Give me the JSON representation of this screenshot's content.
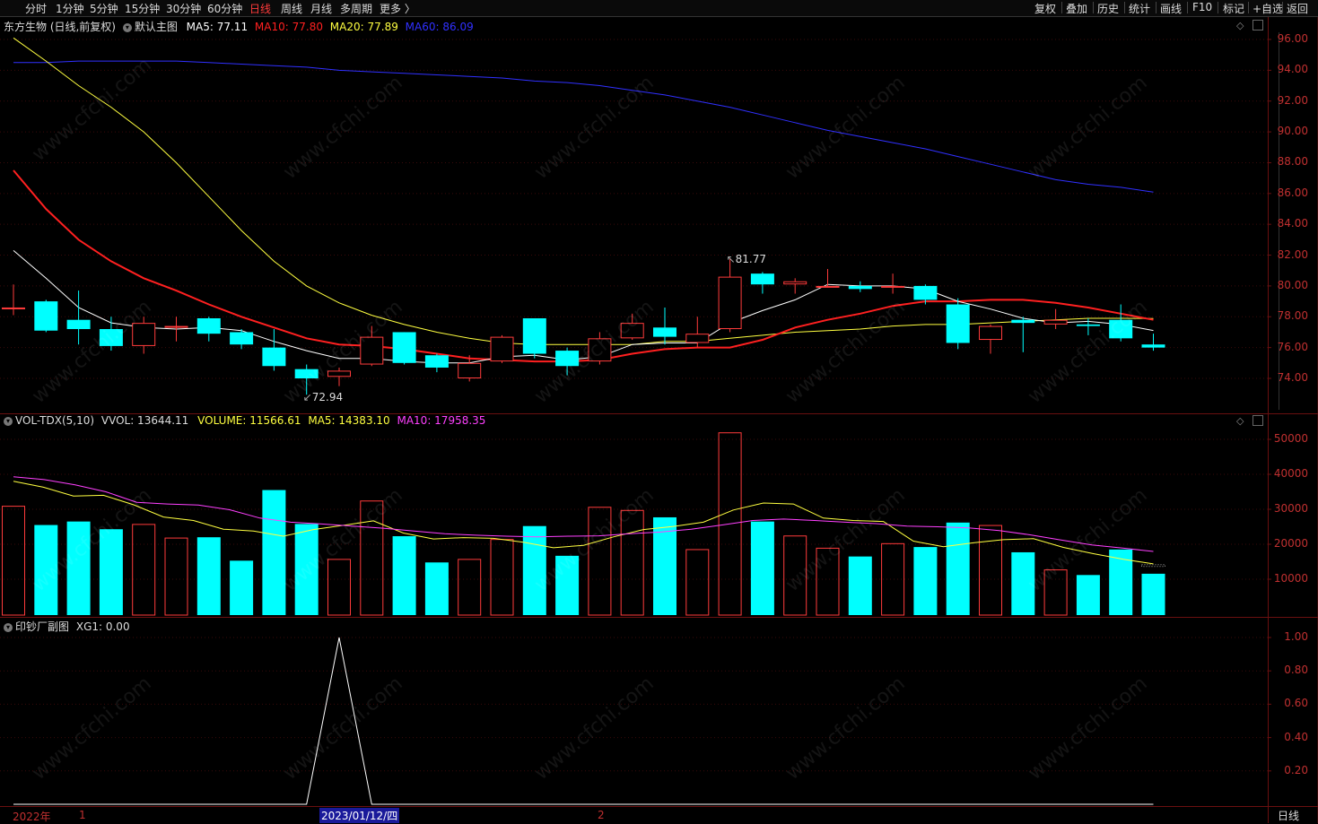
{
  "toolbar": {
    "periods": [
      "分时",
      "1分钟",
      "5分钟",
      "15分钟",
      "30分钟",
      "60分钟",
      "日线",
      "周线",
      "月线",
      "多周期",
      "更多 〉"
    ],
    "active_period": "日线",
    "actions": [
      "复权",
      "叠加",
      "历史",
      "统计",
      "画线",
      "F10",
      "标记",
      "+自选",
      "返回"
    ]
  },
  "main_panel": {
    "title": "东方生物 (日线,前复权)",
    "template": "默认主图",
    "ma5": "MA5: 77.11",
    "ma10": "MA10: 77.80",
    "ma20": "MA20: 77.89",
    "ma60": "MA60: 86.09",
    "high_label": "81.77",
    "low_label": "72.94",
    "yaxis": [
      "96.00",
      "94.00",
      "92.00",
      "90.00",
      "88.00",
      "86.00",
      "84.00",
      "82.00",
      "80.00",
      "78.00",
      "76.00",
      "74.00"
    ]
  },
  "vol_panel": {
    "name": "VOL-TDX(5,10)",
    "vvol": "VVOL: 13644.11",
    "volume": "VOLUME: 11566.61",
    "ma5": "MA5: 14383.10",
    "ma10": "MA10: 17958.35",
    "yaxis": [
      "50000",
      "40000",
      "30000",
      "20000",
      "10000"
    ]
  },
  "sub_panel": {
    "name": "印钞厂副图",
    "xg": "XG1: 0.00",
    "yaxis": [
      "1.00",
      "0.80",
      "0.60",
      "0.40",
      "0.20"
    ]
  },
  "xaxis": {
    "year": "2022年",
    "m1": "1",
    "cursor_date": "2023/01/12/四",
    "m2": "2",
    "period_label": "日线"
  },
  "watermark": "www.cfchi.com",
  "colors": {
    "up": "#ff3b3b",
    "down": "#00ffff",
    "ma5": "#ffffff",
    "ma10": "#ff2020",
    "ma20": "#ffff40",
    "ma60": "#3030ff",
    "vol_ma10": "#ff40ff",
    "grid": "#6a1010"
  },
  "chart_data": {
    "type": "candlestick",
    "candles": [
      {
        "o": 78.6,
        "c": 78.6,
        "h": 80.1,
        "l": 78.1
      },
      {
        "o": 79.0,
        "c": 77.1,
        "h": 79.1,
        "l": 77.0
      },
      {
        "o": 77.8,
        "c": 77.2,
        "h": 79.7,
        "l": 76.2
      },
      {
        "o": 77.2,
        "c": 76.1,
        "h": 78.0,
        "l": 75.8
      },
      {
        "o": 76.1,
        "c": 77.6,
        "h": 78.0,
        "l": 75.6
      },
      {
        "o": 77.4,
        "c": 77.4,
        "h": 78.0,
        "l": 76.4
      },
      {
        "o": 77.9,
        "c": 76.9,
        "h": 78.0,
        "l": 76.4
      },
      {
        "o": 77.0,
        "c": 76.2,
        "h": 77.2,
        "l": 75.9
      },
      {
        "o": 76.0,
        "c": 74.8,
        "h": 77.2,
        "l": 74.5
      },
      {
        "o": 74.6,
        "c": 74.0,
        "h": 74.9,
        "l": 72.94
      },
      {
        "o": 74.1,
        "c": 74.5,
        "h": 74.7,
        "l": 73.5
      },
      {
        "o": 74.9,
        "c": 76.7,
        "h": 77.4,
        "l": 74.8
      },
      {
        "o": 77.0,
        "c": 75.0,
        "h": 77.0,
        "l": 74.9
      },
      {
        "o": 75.5,
        "c": 74.7,
        "h": 75.6,
        "l": 74.4
      },
      {
        "o": 74.0,
        "c": 75.0,
        "h": 75.5,
        "l": 73.8
      },
      {
        "o": 75.1,
        "c": 76.7,
        "h": 76.8,
        "l": 75.0
      },
      {
        "o": 77.9,
        "c": 75.6,
        "h": 77.9,
        "l": 75.3
      },
      {
        "o": 75.8,
        "c": 74.8,
        "h": 76.0,
        "l": 74.2
      },
      {
        "o": 75.1,
        "c": 76.6,
        "h": 77.0,
        "l": 74.9
      },
      {
        "o": 76.6,
        "c": 77.6,
        "h": 78.2,
        "l": 76.5
      },
      {
        "o": 77.3,
        "c": 76.7,
        "h": 78.6,
        "l": 76.2
      },
      {
        "o": 76.3,
        "c": 76.9,
        "h": 78.0,
        "l": 76.0
      },
      {
        "o": 77.2,
        "c": 80.6,
        "h": 81.77,
        "l": 77.0
      },
      {
        "o": 80.8,
        "c": 80.1,
        "h": 80.9,
        "l": 79.5
      },
      {
        "o": 80.1,
        "c": 80.3,
        "h": 80.5,
        "l": 79.5
      },
      {
        "o": 80.0,
        "c": 80.0,
        "h": 81.1,
        "l": 79.9
      },
      {
        "o": 80.0,
        "c": 79.8,
        "h": 80.3,
        "l": 79.6
      },
      {
        "o": 80.0,
        "c": 80.0,
        "h": 80.8,
        "l": 79.5
      },
      {
        "o": 80.0,
        "c": 79.1,
        "h": 80.1,
        "l": 78.8
      },
      {
        "o": 78.8,
        "c": 76.3,
        "h": 79.2,
        "l": 75.9
      },
      {
        "o": 76.5,
        "c": 77.4,
        "h": 77.5,
        "l": 75.6
      },
      {
        "o": 77.8,
        "c": 77.6,
        "h": 78.0,
        "l": 75.7
      },
      {
        "o": 77.5,
        "c": 77.8,
        "h": 78.5,
        "l": 77.2
      },
      {
        "o": 77.5,
        "c": 77.4,
        "h": 77.9,
        "l": 76.8
      },
      {
        "o": 77.8,
        "c": 76.6,
        "h": 78.8,
        "l": 76.4
      },
      {
        "o": 76.2,
        "c": 76.0,
        "h": 76.9,
        "l": 75.8
      }
    ],
    "ma5": [
      82.3,
      80.5,
      78.6,
      77.6,
      77.3,
      77.2,
      77.3,
      77.1,
      76.4,
      75.8,
      75.3,
      75.3,
      75.1,
      75.0,
      75.0,
      75.4,
      75.5,
      75.2,
      75.4,
      76.2,
      76.3,
      76.3,
      77.6,
      78.4,
      79.1,
      80.1,
      80.0,
      80.0,
      79.8,
      79.0,
      78.5,
      77.9,
      77.6,
      77.7,
      77.5,
      77.11
    ],
    "ma10": [
      87.5,
      85.0,
      83.0,
      81.6,
      80.5,
      79.7,
      78.8,
      78.0,
      77.3,
      76.6,
      76.2,
      76.1,
      75.9,
      75.6,
      75.3,
      75.2,
      75.1,
      75.1,
      75.2,
      75.6,
      75.9,
      76.0,
      76.0,
      76.5,
      77.3,
      77.8,
      78.2,
      78.7,
      79.0,
      79.0,
      79.1,
      79.1,
      78.9,
      78.6,
      78.2,
      77.8
    ],
    "ma20": [
      96.1,
      94.6,
      93.0,
      91.6,
      90.0,
      88.0,
      85.8,
      83.6,
      81.6,
      80.0,
      78.9,
      78.1,
      77.5,
      77.0,
      76.6,
      76.3,
      76.2,
      76.2,
      76.2,
      76.2,
      76.4,
      76.4,
      76.6,
      76.8,
      77.0,
      77.1,
      77.2,
      77.4,
      77.5,
      77.5,
      77.6,
      77.7,
      77.8,
      77.9,
      77.9,
      77.89
    ],
    "ma60": [
      94.5,
      94.5,
      94.6,
      94.6,
      94.6,
      94.6,
      94.5,
      94.4,
      94.3,
      94.2,
      94.0,
      93.9,
      93.8,
      93.7,
      93.6,
      93.5,
      93.3,
      93.2,
      93.0,
      92.7,
      92.4,
      92.0,
      91.6,
      91.1,
      90.6,
      90.1,
      89.7,
      89.3,
      88.9,
      88.4,
      87.9,
      87.4,
      86.9,
      86.6,
      86.4,
      86.09
    ],
    "volume": [
      31000,
      25500,
      26500,
      24300,
      25800,
      21900,
      22000,
      15300,
      35500,
      25800,
      15800,
      32500,
      22300,
      14800,
      15800,
      21500,
      25200,
      16700,
      30700,
      29800,
      27700,
      18600,
      52000,
      26500,
      22500,
      19000,
      16500,
      20300,
      19200,
      26200,
      25500,
      17700,
      12800,
      11200,
      18500,
      11566.61
    ],
    "vol_ma5": [
      38000,
      36300,
      33800,
      34000,
      31300,
      27800,
      26800,
      24300,
      23800,
      22300,
      24200,
      25400,
      26700,
      23200,
      21500,
      21900,
      21700,
      20600,
      19000,
      19700,
      22100,
      24200,
      25100,
      26300,
      29800,
      31800,
      31500,
      27500,
      26800,
      26500,
      20900,
      19300,
      20400,
      21300,
      21600,
      19100,
      17300,
      15700,
      14383.1
    ],
    "vol_ma10": [
      39300,
      38500,
      37000,
      35000,
      32000,
      31500,
      31200,
      29900,
      27500,
      26300,
      25800,
      25200,
      24600,
      23800,
      23000,
      22600,
      22300,
      22100,
      22300,
      22400,
      23000,
      23500,
      24300,
      25500,
      26800,
      27200,
      26800,
      26300,
      25900,
      25200,
      25000,
      24700,
      23900,
      22700,
      21200,
      19800,
      18900,
      17958.35
    ],
    "xg1": [
      0,
      0,
      0,
      0,
      0,
      0,
      0,
      0,
      0,
      0,
      1,
      0,
      0,
      0,
      0,
      0,
      0,
      0,
      0,
      0,
      0,
      0,
      0,
      0,
      0,
      0,
      0,
      0,
      0,
      0,
      0,
      0,
      0,
      0,
      0,
      0
    ]
  }
}
